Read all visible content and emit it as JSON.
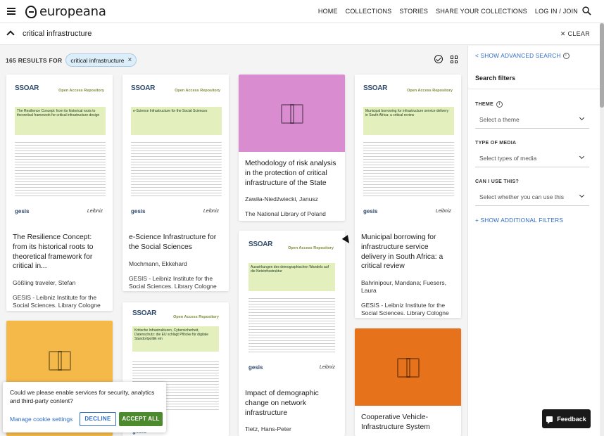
{
  "header": {
    "logo_text": "europeana",
    "nav": [
      "HOME",
      "COLLECTIONS",
      "STORIES",
      "SHARE YOUR COLLECTIONS",
      "LOG IN / JOIN"
    ]
  },
  "search": {
    "query": "critical infrastructure",
    "clear_label": "CLEAR"
  },
  "results": {
    "count_label": "165 RESULTS FOR",
    "chip": "critical infrastructure",
    "chip_remove": "×"
  },
  "cards": [
    {
      "title": "The Resilience Concept: from its historical roots to theoretical framework for critical in...",
      "creator": "Gößling traveler, Stefan",
      "provider": "GESIS - Leibniz Institute for the Social Sciences. Library Cologne",
      "thumb_type": "document",
      "doc_title": "The Resilience Concept: from its historical roots to theoretical framework for critical infrastructure design"
    },
    {
      "title": "e-Science Infrastructure for the Social Sciences",
      "creator": "Mochmann, Ekkehard",
      "provider": "GESIS - Leibniz Institute for the Social Sciences. Library Cologne",
      "thumb_type": "document",
      "doc_title": "e-Science Infrastructure for the Social Sciences"
    },
    {
      "title": "Methodology of risk analysis in the protection of critical infrastructure of the State",
      "creator": "Zawiła-Niedźwiecki, Janusz",
      "provider": "The National Library of Poland",
      "thumb_type": "color",
      "thumb_color": "#d98ccf"
    },
    {
      "title": "Municipal borrowing for infrastructure service delivery in South Africa: a critical review",
      "creator": "Bahrinipour, Mandana; Fuesers, Laura",
      "provider": "GESIS - Leibniz Institute for the Social Sciences. Library Cologne",
      "thumb_type": "document",
      "doc_title": "Municipal borrowing for infrastructure service delivery in South Africa: a critical review"
    },
    {
      "title": "Impact of demographic change on network infrastructure",
      "creator": "Tietz, Hans-Peter",
      "thumb_type": "document",
      "doc_title": "Auswirkungen des demographischen Wandels auf die Netzinfrastruktur"
    },
    {
      "title": "",
      "thumb_type": "color",
      "thumb_color": "#f5b94a"
    },
    {
      "title": "",
      "thumb_type": "document",
      "doc_title": "Kritische Infrastrukturen, Cybersicherheit, Datenschutz: die EU schlägt Pflöcke für digitale Standortpolitik ein"
    },
    {
      "title": "Cooperative Vehicle-Infrastructure System",
      "thumb_type": "color",
      "thumb_color": "#e6721b"
    }
  ],
  "doc_thumb": {
    "brand": "SSOAR",
    "repo": "Open Access Repository",
    "footer": "gesis",
    "sign": "Leibniz"
  },
  "sidebar": {
    "advanced": "< SHOW ADVANCED SEARCH",
    "title": "Search filters",
    "filters": [
      {
        "label": "THEME",
        "placeholder": "Select a theme",
        "info": true
      },
      {
        "label": "TYPE OF MEDIA",
        "placeholder": "Select types of media",
        "info": false
      },
      {
        "label": "CAN I USE THIS?",
        "placeholder": "Select whether you can use this",
        "info": false
      }
    ],
    "more": "+ SHOW ADDITIONAL FILTERS"
  },
  "cookie": {
    "text": "Could we please enable services for security, analytics and third-party content?",
    "manage": "Manage cookie settings",
    "decline": "DECLINE",
    "accept": "ACCEPT ALL"
  },
  "feedback": {
    "label": "Feedback"
  },
  "colors": {
    "link": "#2f6bc3",
    "accept": "#4d8a2e",
    "chip_bg": "#dceef9"
  }
}
